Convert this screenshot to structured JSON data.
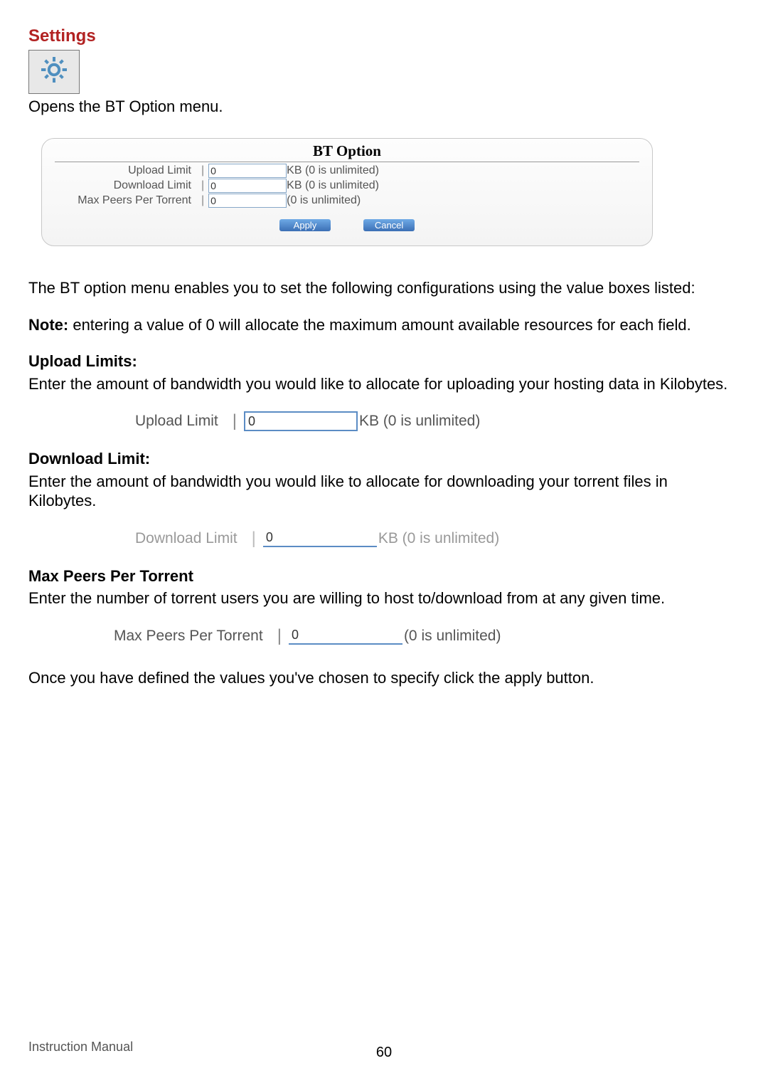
{
  "section": {
    "title": "Settings",
    "opens_text": "Opens the BT Option menu."
  },
  "panel": {
    "title": "BT Option",
    "rows": [
      {
        "label": "Upload Limit",
        "value": "0",
        "suffix": "KB (0 is unlimited)"
      },
      {
        "label": "Download Limit",
        "value": "0",
        "suffix": "KB (0 is unlimited)"
      },
      {
        "label": "Max Peers Per Torrent",
        "value": "0",
        "suffix": "(0 is unlimited)"
      }
    ],
    "apply": "Apply",
    "cancel": "Cancel"
  },
  "intro_para": "The BT option menu enables you to set the following configurations using the value boxes listed:",
  "note_label": "Note:",
  "note_text": " entering a value of 0 will allocate the maximum amount available resources for each field.",
  "upload": {
    "heading": "Upload Limits:",
    "desc": "Enter the amount of bandwidth you would like to allocate for uploading your hosting data in Kilobytes.",
    "label": "Upload Limit",
    "value": "0",
    "suffix": "KB (0 is unlimited)"
  },
  "download": {
    "heading": "Download Limit:",
    "desc": "Enter the amount of bandwidth you would like to allocate for downloading your torrent files in Kilobytes.",
    "label": "Download Limit",
    "value": "0",
    "suffix": "KB (0 is unlimited)"
  },
  "peers": {
    "heading": "Max Peers Per Torrent",
    "desc": "Enter the number of torrent users you are willing to host to/download  from at any given time.",
    "label": "Max Peers Per Torrent",
    "value": "0",
    "suffix": "(0 is unlimited)"
  },
  "closing": "Once you have defined the values you've chosen to specify click the apply button.",
  "footer": "Instruction Manual",
  "page": "60"
}
